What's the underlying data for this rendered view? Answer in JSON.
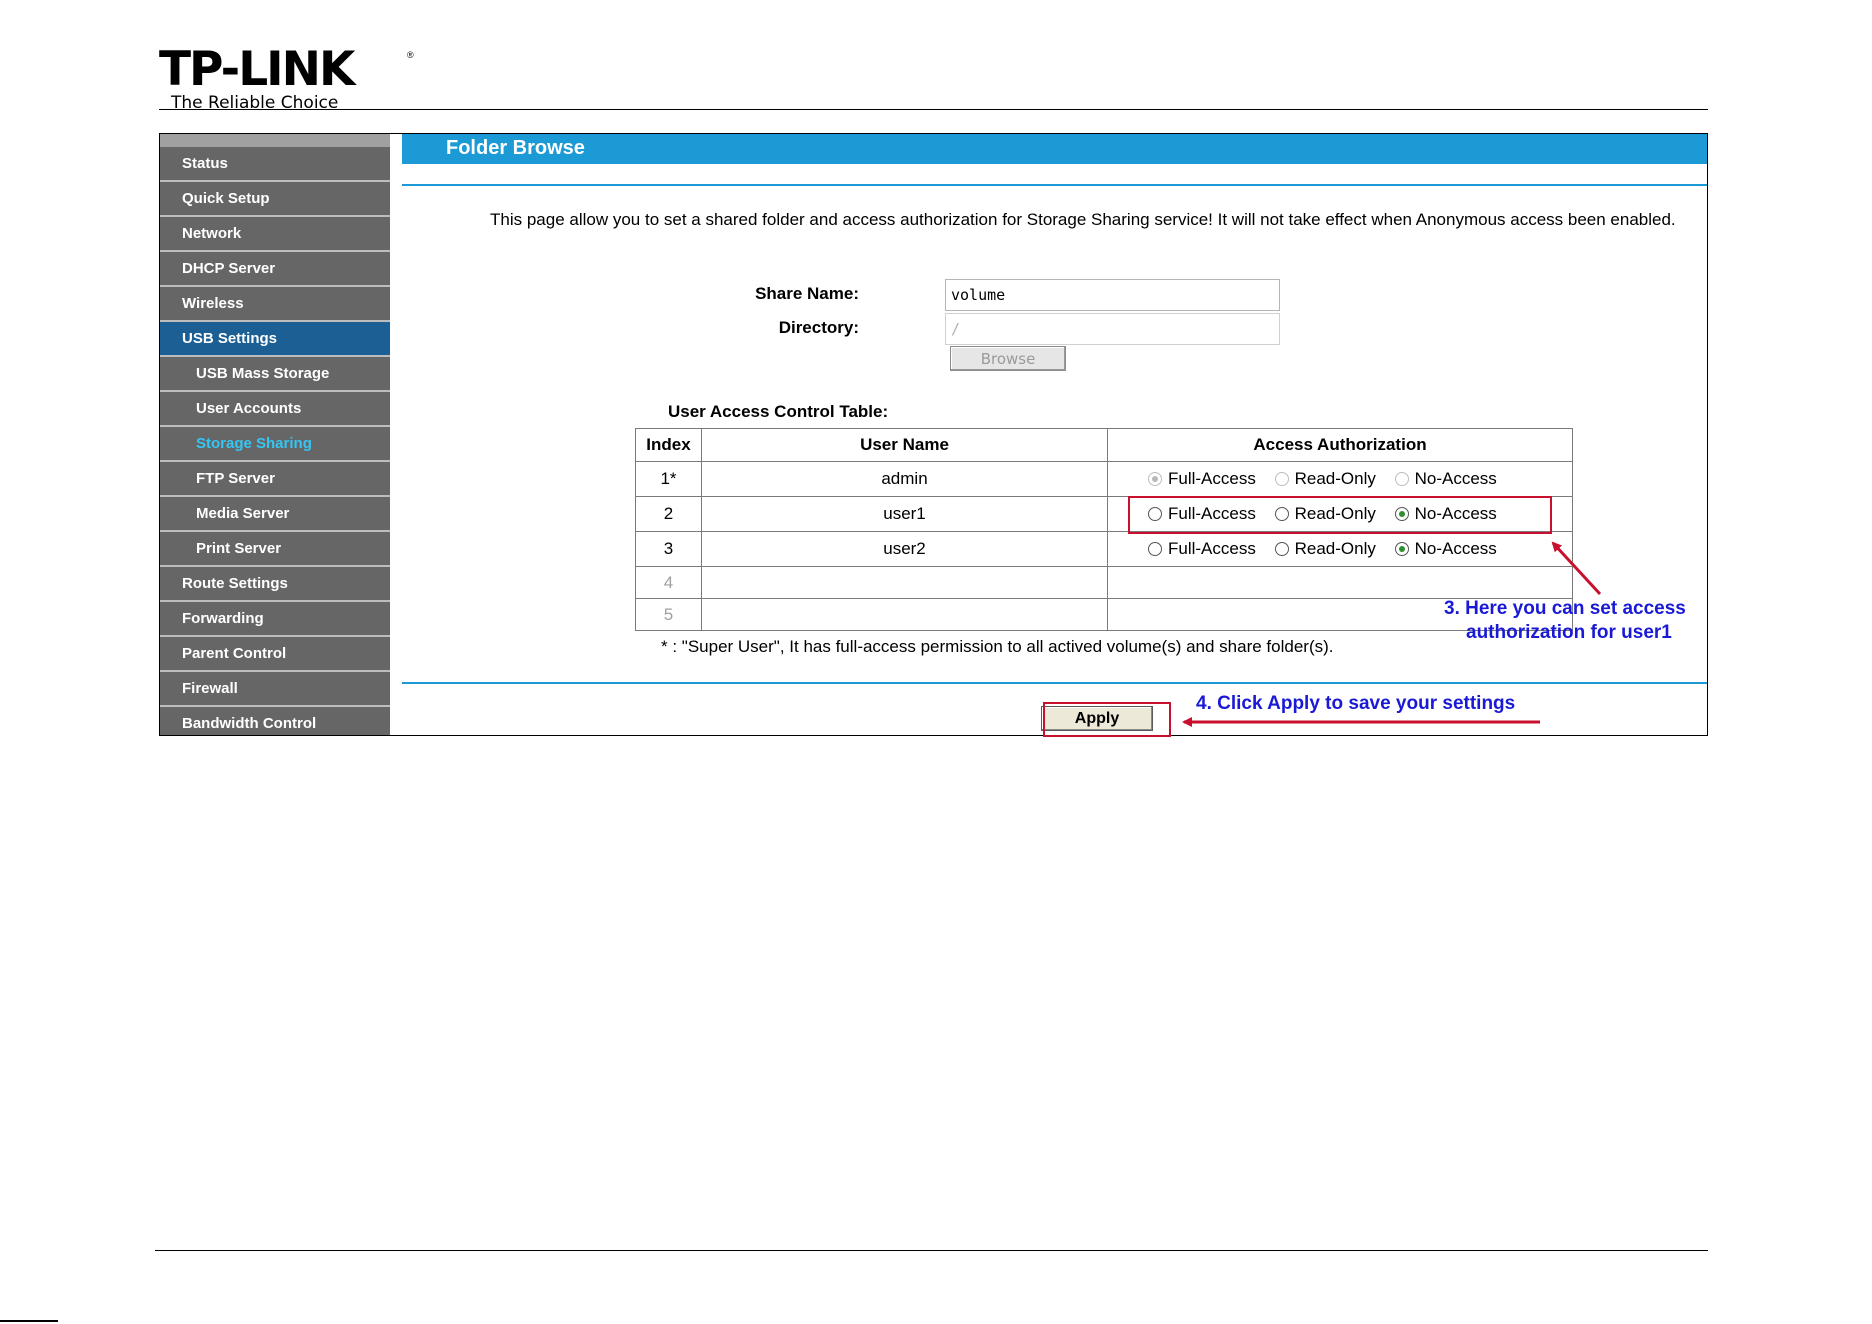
{
  "header": {
    "brand": "TP-LINK",
    "registered": "®",
    "tagline": "The Reliable Choice"
  },
  "sidebar": {
    "items": [
      {
        "label": "Status"
      },
      {
        "label": "Quick Setup"
      },
      {
        "label": "Network"
      },
      {
        "label": "DHCP Server"
      },
      {
        "label": "Wireless"
      },
      {
        "label": "USB Settings"
      },
      {
        "label": "USB Mass Storage"
      },
      {
        "label": "User Accounts"
      },
      {
        "label": "Storage Sharing"
      },
      {
        "label": "FTP Server"
      },
      {
        "label": "Media Server"
      },
      {
        "label": "Print Server"
      },
      {
        "label": "Route Settings"
      },
      {
        "label": "Forwarding"
      },
      {
        "label": "Parent Control"
      },
      {
        "label": "Firewall"
      },
      {
        "label": "Bandwidth Control"
      }
    ]
  },
  "main": {
    "title": "Folder Browse",
    "description": "This page allow you to set a shared folder and access authorization for Storage Sharing service! It will not take effect when Anonymous access been enabled.",
    "share_name_label": "Share Name:",
    "share_name_value": "volume",
    "directory_label": "Directory:",
    "directory_value": "/",
    "browse_label": "Browse",
    "table_title": "User Access Control Table:",
    "table": {
      "headers": [
        "Index",
        "User Name",
        "Access Authorization"
      ],
      "options": [
        "Full-Access",
        "Read-Only",
        "No-Access"
      ],
      "rows": [
        {
          "index": "1*",
          "user": "admin",
          "selected": "Full-Access",
          "disabled": true
        },
        {
          "index": "2",
          "user": "user1",
          "selected": "No-Access",
          "disabled": false
        },
        {
          "index": "3",
          "user": "user2",
          "selected": "No-Access",
          "disabled": false
        },
        {
          "index": "4",
          "user": "",
          "selected": "",
          "disabled": true
        },
        {
          "index": "5",
          "user": "",
          "selected": "",
          "disabled": true
        }
      ]
    },
    "footnote": "* : \"Super User\", It has full-access permission to all actived volume(s) and share folder(s).",
    "apply_label": "Apply"
  },
  "annotations": {
    "step3_line1": "3. Here you can set access",
    "step3_line2": "authorization for user1",
    "step4": "4. Click Apply to save your settings"
  },
  "colors": {
    "accent_blue": "#1c9ad6",
    "sidebar_bg": "#666666",
    "sidebar_active": "#1b5f94",
    "current_link": "#34c6f4",
    "annotation_red": "#c8102e",
    "annotation_blue": "#1a1ad6"
  }
}
